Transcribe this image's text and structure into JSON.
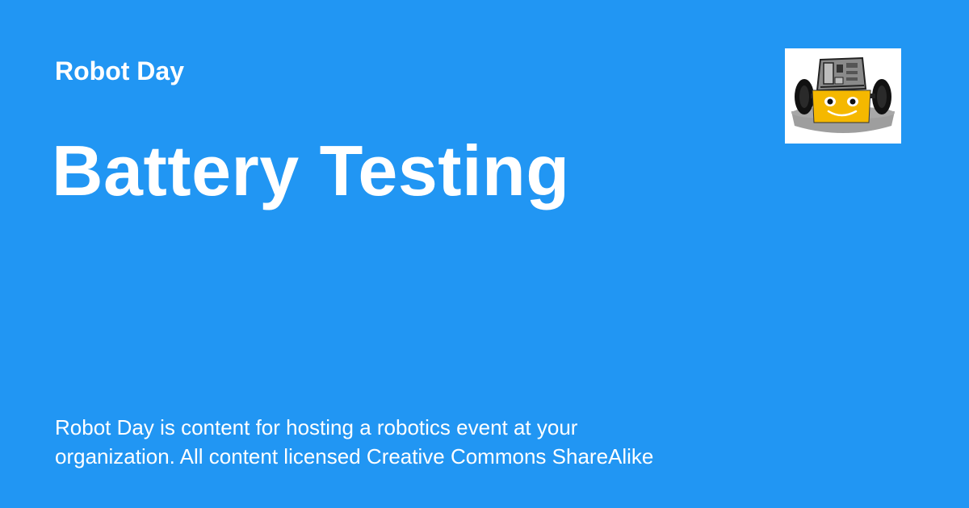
{
  "header": {
    "site_name": "Robot Day",
    "logo_icon": "robot-logo-icon"
  },
  "main": {
    "title": "Battery Testing"
  },
  "footer": {
    "description_line1": "Robot Day is content for hosting a robotics event at your",
    "description_line2": "organization. All content licensed Creative Commons ShareAlike"
  },
  "colors": {
    "background": "#2196f3",
    "text": "#ffffff",
    "logo_face": "#f5b800",
    "logo_base": "#9e9e9e"
  }
}
